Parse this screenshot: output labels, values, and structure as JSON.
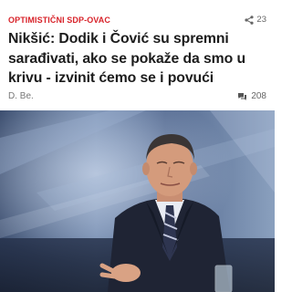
{
  "article": {
    "category": "OPTIMISTIČNI SDP-OVAC",
    "share_count": "23",
    "headline": "Nikšić: Dodik i Čović su spremni sarađivati, ako se pokaže da smo u krivu - izvinit ćemo se i povući",
    "author": "D. Be.",
    "comment_count": "208"
  },
  "colors": {
    "category": "#d8232a",
    "icon": "#666666"
  },
  "icons": {
    "share": "share-icon",
    "comments": "comments-icon"
  }
}
